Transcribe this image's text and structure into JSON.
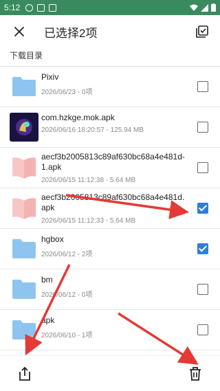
{
  "status_bar": {
    "time": "5:12",
    "background": "#3a8a5f"
  },
  "app_bar": {
    "close_icon": "close-icon",
    "title": "已选择2项",
    "select_all_icon": "select-all-icon"
  },
  "breadcrumb": "下载目录",
  "accent_color": "#2f7fd6",
  "files": [
    {
      "name": "Pixiv",
      "meta": "2026/06/23 - 0项",
      "icon": "folder-icon",
      "checked": false
    },
    {
      "name": "com.hzkge.mok.apk",
      "meta": "2026/06/16 18:20:57 - 125.94 MB",
      "icon": "app-icon",
      "checked": false
    },
    {
      "name": "aecf3b2005813c89af630bc68a4e481d-1.apk",
      "meta": "2026/06/15 11:12:38 - 5.64 MB",
      "icon": "book-icon",
      "checked": false
    },
    {
      "name": "aecf3b2005813c89af630bc68a4e481d.apk",
      "meta": "2026/06/15 11:12:33 - 5.64 MB",
      "icon": "book-icon",
      "checked": true
    },
    {
      "name": "hgbox",
      "meta": "2026/06/12 - 2项",
      "icon": "folder-icon",
      "checked": true
    },
    {
      "name": "bm",
      "meta": "2026/06/12 - 0项",
      "icon": "folder-icon",
      "checked": false
    },
    {
      "name": "apk",
      "meta": "2026/06/10 - 1项",
      "icon": "folder-icon",
      "checked": false
    }
  ],
  "bottom_bar": {
    "share_icon": "share-icon",
    "delete_icon": "delete-icon"
  },
  "annotation_color": "#e53935"
}
